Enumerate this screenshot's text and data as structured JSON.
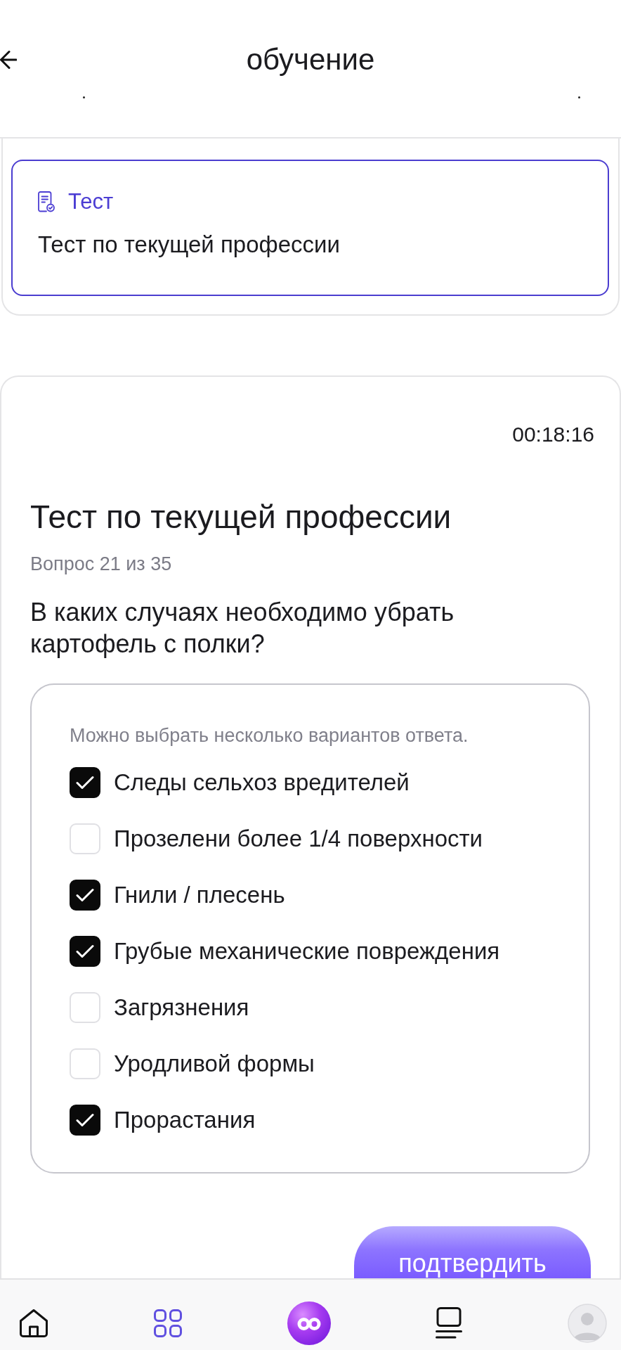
{
  "header": {
    "title": "обучение"
  },
  "material": {
    "type_label": "Тест",
    "title": "Тест по текущей профессии",
    "selected": true
  },
  "test": {
    "timer": "00:18:16",
    "title": "Тест по текущей профессии",
    "progress": "Вопрос 21 из 35",
    "question": "В каких случаях необходимо убрать картофель с полки?",
    "hint": "Можно выбрать несколько вариантов ответа.",
    "options": [
      {
        "label": "Следы сельхоз вредителей",
        "checked": true
      },
      {
        "label": "Прозелени более 1/4 поверхности",
        "checked": false
      },
      {
        "label": "Гнили / плесень",
        "checked": true
      },
      {
        "label": "Грубые механические повреждения",
        "checked": true
      },
      {
        "label": "Загрязнения",
        "checked": false
      },
      {
        "label": "Уродливой формы",
        "checked": false
      },
      {
        "label": "Прорастания",
        "checked": true
      }
    ],
    "submit": "подтвердить"
  },
  "nav": {
    "items": [
      {
        "kind": "home",
        "selected": false
      },
      {
        "kind": "grid",
        "selected": true
      },
      {
        "kind": "infinity",
        "selected": false
      },
      {
        "kind": "list",
        "selected": false
      },
      {
        "kind": "avatar",
        "selected": false
      }
    ]
  }
}
